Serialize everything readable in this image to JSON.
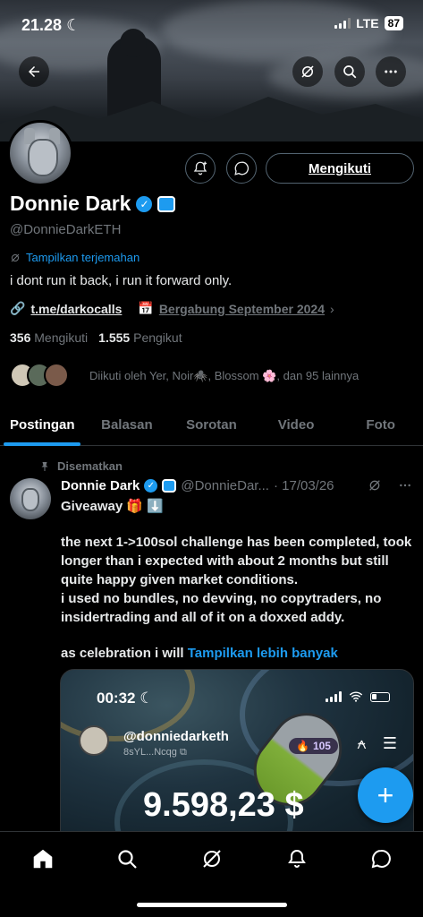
{
  "status_bar": {
    "time": "21.28",
    "network": "LTE",
    "battery": "87"
  },
  "profile": {
    "display_name": "Donnie Dark",
    "handle": "@DonnieDarkETH",
    "translate_label": "Tampilkan terjemahan",
    "bio": "i dont run it back, i run it forward only.",
    "link": "t.me/darkocalls",
    "joined": "Bergabung September 2024",
    "following_count": "356",
    "following_label": "Mengikuti",
    "followers_count": "1.555",
    "followers_label": "Pengikut",
    "followed_by": "Diikuti oleh Yer, Noir🕷️, Blossom 🌸, dan 95 lainnya",
    "follow_button": "Mengikuti"
  },
  "tabs": [
    {
      "label": "Postingan",
      "active": true
    },
    {
      "label": "Balasan",
      "active": false
    },
    {
      "label": "Sorotan",
      "active": false
    },
    {
      "label": "Video",
      "active": false
    },
    {
      "label": "Foto",
      "active": false
    }
  ],
  "post": {
    "pinned_label": "Disematkan",
    "author_name": "Donnie Dark",
    "author_handle": "@DonnieDar...",
    "date": "· 17/03/26",
    "line1": "Giveaway 🎁 ⬇️",
    "paragraph": "the next 1->100sol challenge has been completed, took longer than i expected with about 2 months but still quite happy given market conditions.",
    "paragraph2": "i used no bundles, no devving, no copytraders, no insidertrading and all of it on a doxxed addy.",
    "paragraph3": "as celebration i will",
    "show_more": "Tampilkan lebih banyak",
    "media": {
      "time": "00:32",
      "handle": "@donniedarketh",
      "address": "8sYL...Ncqg",
      "badge": "105",
      "amount": "9.598,23 $"
    }
  },
  "icons": {
    "back": "arrow-left-icon",
    "grok": "grok-icon",
    "search": "search-icon",
    "more": "more-icon",
    "notify": "notification-add-icon",
    "message": "message-icon",
    "home": "home-icon",
    "explore": "search-icon",
    "grok_nav": "grok-icon",
    "notifications": "bell-icon",
    "messages": "message-icon"
  },
  "colors": {
    "accent": "#1d9bf0",
    "background": "#000000",
    "muted": "#71767b"
  }
}
